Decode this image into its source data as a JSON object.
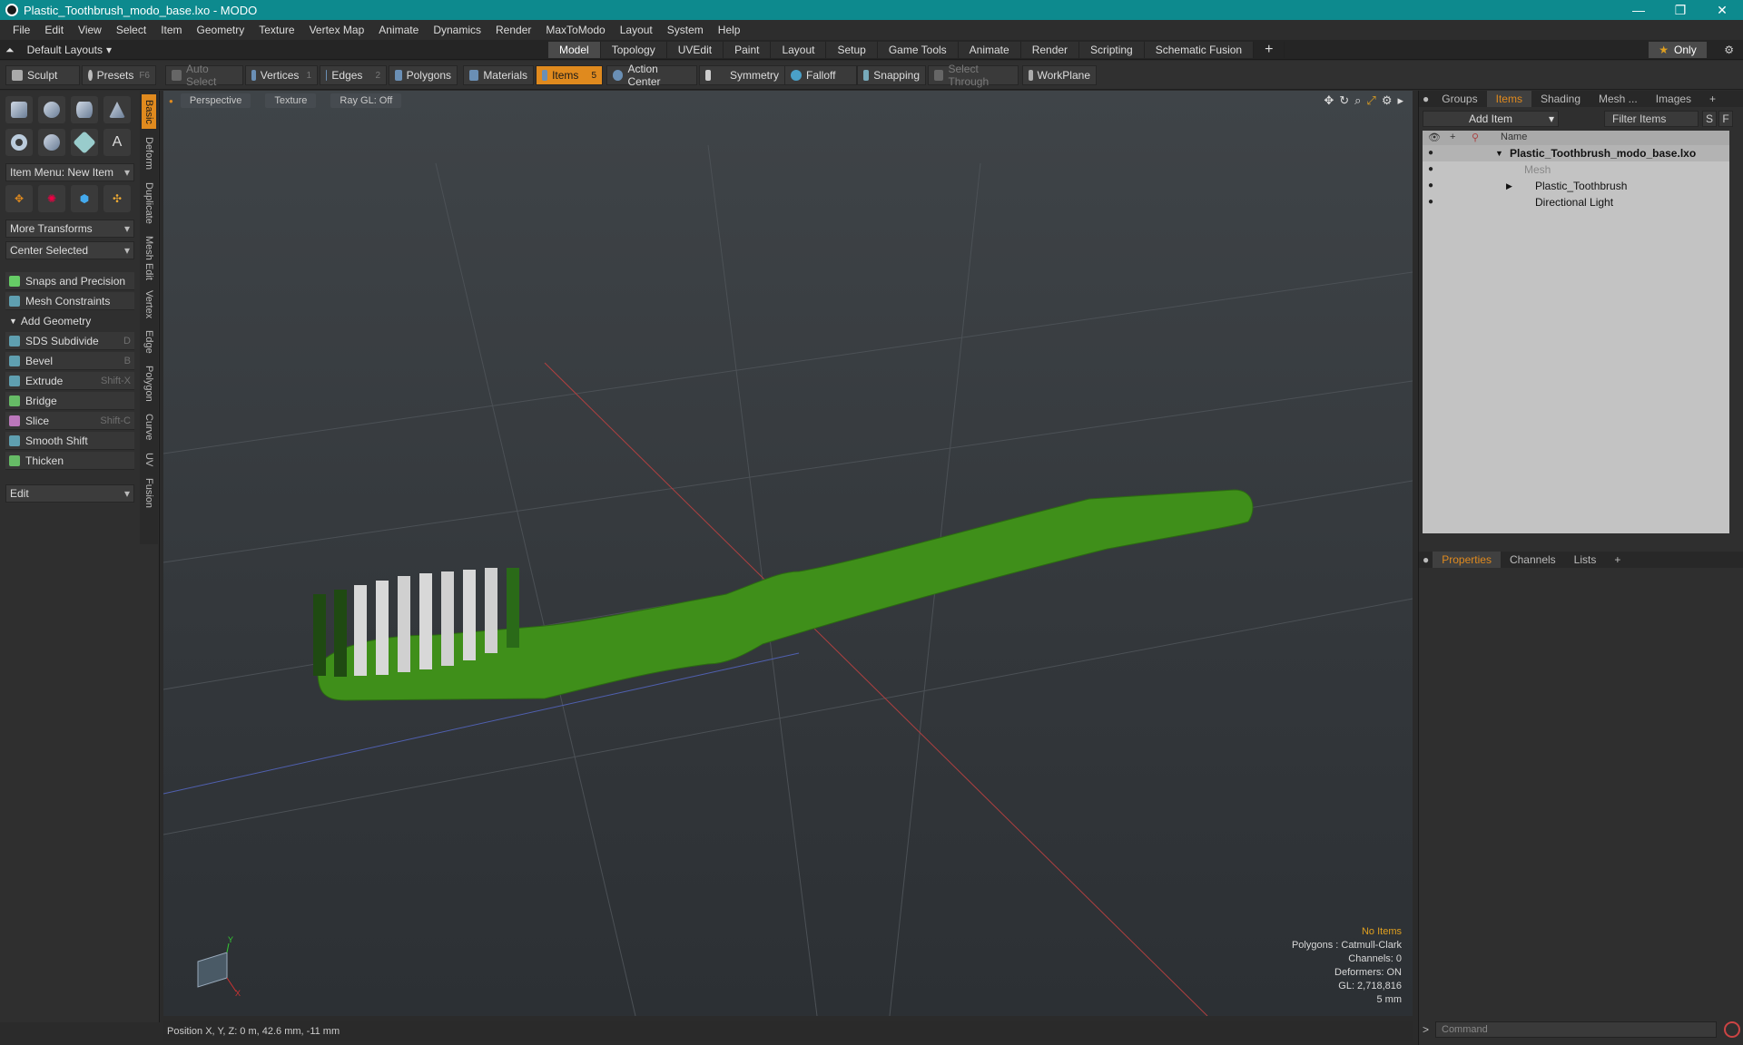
{
  "window": {
    "title": "Plastic_Toothbrush_modo_base.lxo - MODO"
  },
  "menu": [
    "File",
    "Edit",
    "View",
    "Select",
    "Item",
    "Geometry",
    "Texture",
    "Vertex Map",
    "Animate",
    "Dynamics",
    "Render",
    "MaxToModo",
    "Layout",
    "System",
    "Help"
  ],
  "layout": {
    "selector": "Default Layouts",
    "tabs": [
      "Model",
      "Topology",
      "UVEdit",
      "Paint",
      "Layout",
      "Setup",
      "Game Tools",
      "Animate",
      "Render",
      "Scripting",
      "Schematic Fusion"
    ],
    "active_tab": "Model",
    "only_label": "Only"
  },
  "toolbar": {
    "sculpt": "Sculpt",
    "presets": "Presets",
    "presets_key": "F6",
    "auto_select": "Auto Select",
    "vertices": "Vertices",
    "vertices_count": "1",
    "edges": "Edges",
    "edges_count": "2",
    "polygons": "Polygons",
    "materials": "Materials",
    "items": "Items",
    "items_count": "5",
    "action_center": "Action Center",
    "symmetry": "Symmetry",
    "falloff": "Falloff",
    "snapping": "Snapping",
    "select_through": "Select Through",
    "workplane": "WorkPlane"
  },
  "left_panel": {
    "vtabs": [
      "Basic",
      "Deform",
      "Duplicate",
      "Mesh Edit",
      "Vertex",
      "Edge",
      "Polygon",
      "Curve",
      "UV",
      "Fusion"
    ],
    "item_menu": "Item Menu: New Item",
    "more_transforms": "More Transforms",
    "center_selected": "Center Selected",
    "snaps": "Snaps and Precision",
    "mesh_constraints": "Mesh Constraints",
    "add_geometry": "Add Geometry",
    "tools": [
      {
        "label": "SDS Subdivide",
        "key": "D"
      },
      {
        "label": "Bevel",
        "key": "B"
      },
      {
        "label": "Extrude",
        "key": "Shift-X"
      },
      {
        "label": "Bridge",
        "key": ""
      },
      {
        "label": "Slice",
        "key": "Shift-C"
      },
      {
        "label": "Smooth Shift",
        "key": ""
      },
      {
        "label": "Thicken",
        "key": ""
      }
    ],
    "edit": "Edit"
  },
  "viewport": {
    "view": "Perspective",
    "shading": "Texture",
    "raygl": "Ray GL: Off",
    "info": {
      "no_items": "No Items",
      "polygons": "Polygons : Catmull-Clark",
      "channels": "Channels: 0",
      "deformers": "Deformers: ON",
      "gl": "GL: 2,718,816",
      "scale": "5 mm"
    },
    "axis_labels": {
      "y": "Y",
      "x": "X"
    },
    "colors": {
      "toothbrush": "#3f8f1a",
      "bristle_dark": "#1f4a12",
      "bristle_light": "#d8d8d8"
    }
  },
  "status": {
    "position": "Position X, Y, Z:   0 m, 42.6 mm, -11 mm"
  },
  "right_panel": {
    "tabs": [
      "Groups",
      "Items",
      "Shading",
      "Mesh ...",
      "Images"
    ],
    "active_tab": "Items",
    "add_item": "Add Item",
    "filter": "Filter Items",
    "s_btn": "S",
    "f_btn": "F",
    "name_col": "Name",
    "tree": [
      {
        "label": "Plastic_Toothbrush_modo_base.lxo",
        "level": 0
      },
      {
        "label": "Mesh",
        "level": 1
      },
      {
        "label": "Plastic_Toothbrush",
        "level": 1
      },
      {
        "label": "Directional Light",
        "level": 1
      }
    ],
    "prop_tabs": [
      "Properties",
      "Channels",
      "Lists"
    ],
    "command_placeholder": "Command"
  }
}
